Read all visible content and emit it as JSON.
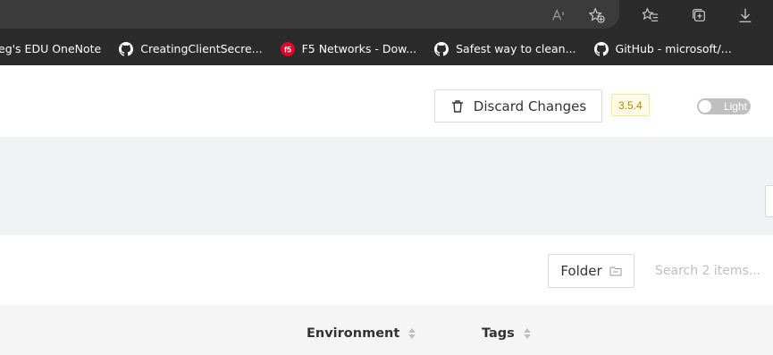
{
  "browser": {
    "icons": [
      "read-aloud-icon",
      "add-favorite-icon",
      "favorites-icon",
      "collections-icon",
      "downloads-icon"
    ],
    "bookmarks": [
      {
        "label": "eg's EDU OneNote",
        "icon": "onenote-icon"
      },
      {
        "label": "CreatingClientSecre...",
        "icon": "github-icon"
      },
      {
        "label": "F5 Networks - Dow...",
        "icon": "f5-icon"
      },
      {
        "label": "Safest way to clean...",
        "icon": "github-icon"
      },
      {
        "label": "GitHub - microsoft/...",
        "icon": "github-icon"
      }
    ]
  },
  "header": {
    "discard_label": "Discard Changes",
    "version": "3.5.4",
    "theme_label": "Light"
  },
  "toolbar": {
    "folder_label": "Folder",
    "search_placeholder": "Search 2 items..."
  },
  "table": {
    "columns": [
      "Environment",
      "Tags"
    ]
  },
  "colors": {
    "browser_bg": "#2b2b2b",
    "band_bg": "#f0f2f5",
    "badge_bg": "#fffbe6",
    "badge_text": "#b58a00",
    "f5_red": "#e4002b"
  }
}
